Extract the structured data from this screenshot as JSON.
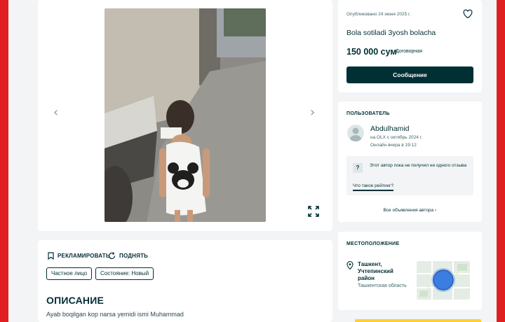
{
  "gallery": {
    "prev_icon": "chevron-left-icon",
    "next_icon": "chevron-right-icon",
    "expand_icon": "expand-icon"
  },
  "details": {
    "promote_label": "РЕКЛАМИРОВАТЬ",
    "raise_label": "ПОДНЯТЬ",
    "tags": [
      "Частное лицо",
      "Состояние: Новый"
    ],
    "description_title": "ОПИСАНИЕ",
    "description_text": "Ayab boqilgan kop narsa yemidi ismi Muhammad"
  },
  "listing": {
    "published": "Опубликовано 24 июня 2025 г.",
    "title": "Bola sotiladi 3yosh bolacha",
    "price": "150 000 сум",
    "negotiable": "Договорная",
    "message_button": "Сообщение"
  },
  "user": {
    "section_title": "ПОЛЬЗОВАТЕЛЬ",
    "name": "Abdulhamid",
    "since": "на OLX с октябрь 2024 г.",
    "online": "Онлайн вчера в 19:12",
    "rating_text": "Этот автор пока не получил ни одного отзыва",
    "rating_link": "Что такое рейтинг?",
    "all_ads": "Все объявления автора"
  },
  "location": {
    "section_title": "МЕСТОПОЛОЖЕНИЕ",
    "city": "Ташкент, Учтепинский район",
    "region": "Ташкентская область"
  },
  "colors": {
    "brand_dark": "#002f34",
    "frame_red": "#e02020",
    "map_marker": "#3b7de0"
  }
}
